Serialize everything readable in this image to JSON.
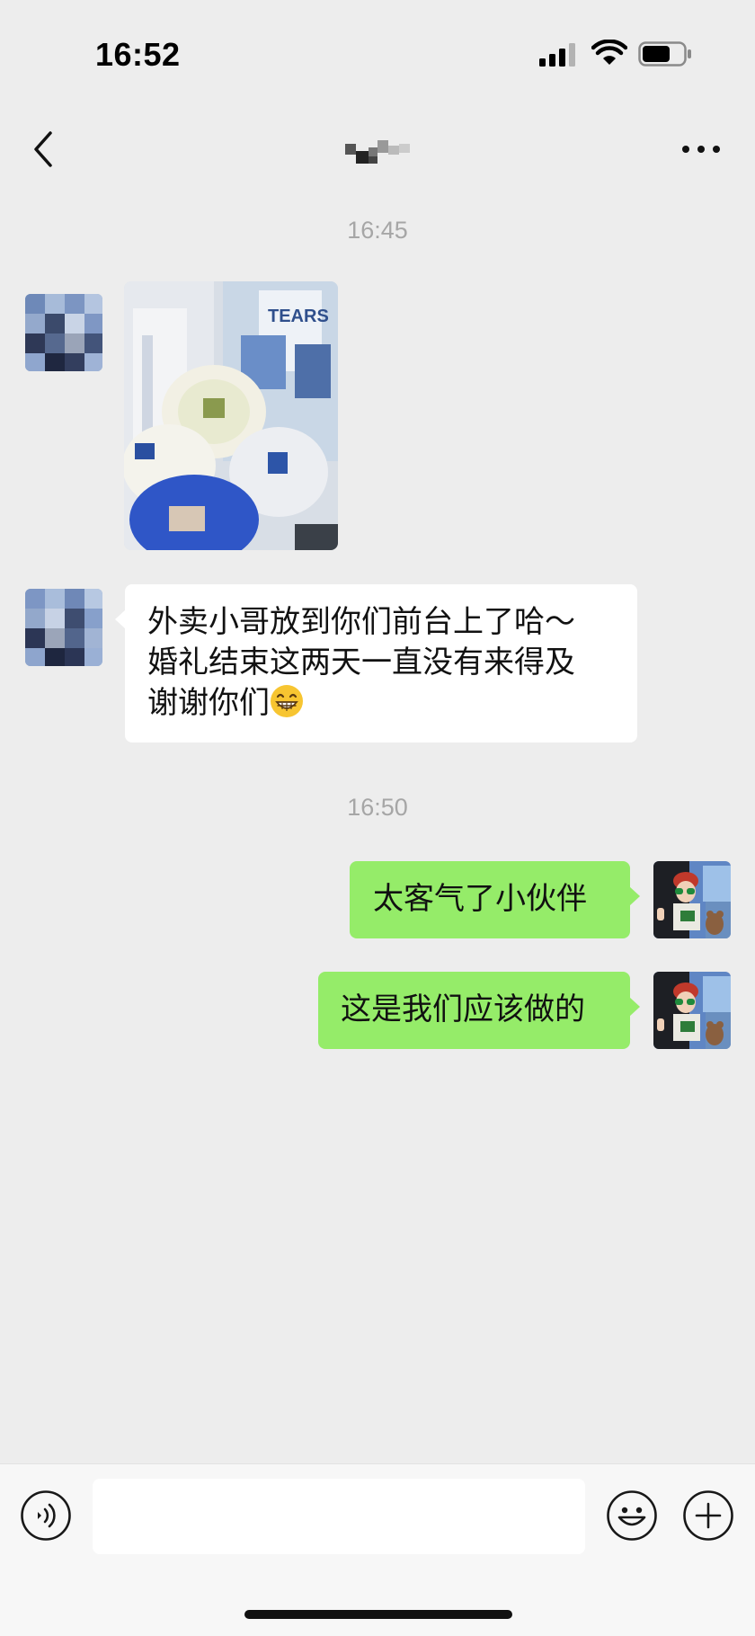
{
  "status_bar": {
    "time": "16:52",
    "icons": [
      "signal-icon",
      "wifi-icon",
      "battery-icon"
    ]
  },
  "nav": {
    "back_icon": "chevron-left-icon",
    "title": "",
    "more_icon": "more-dots-icon"
  },
  "messages": [
    {
      "type": "timestamp",
      "text": "16:45"
    },
    {
      "type": "image",
      "direction": "incoming",
      "sender_avatar": "avatar-pixelated"
    },
    {
      "type": "text",
      "direction": "incoming",
      "sender_avatar": "avatar-pixelated",
      "lines": [
        "外卖小哥放到你们前台上了哈～",
        "婚礼结束这两天一直没有来得及",
        "谢谢你们"
      ],
      "emoji": "grinning-face-emoji"
    },
    {
      "type": "timestamp",
      "text": "16:50"
    },
    {
      "type": "text",
      "direction": "outgoing",
      "sender_avatar": "avatar-self",
      "text": "太客气了小伙伴"
    },
    {
      "type": "text",
      "direction": "outgoing",
      "sender_avatar": "avatar-self",
      "text": "这是我们应该做的"
    }
  ],
  "input_bar": {
    "value": "",
    "voice_icon": "voice-icon",
    "emoji_icon": "emoji-icon",
    "plus_icon": "plus-icon"
  },
  "colors": {
    "background": "#ededed",
    "incoming_bubble": "#ffffff",
    "outgoing_bubble": "#95ec69",
    "timestamp": "#a6a6a6"
  }
}
